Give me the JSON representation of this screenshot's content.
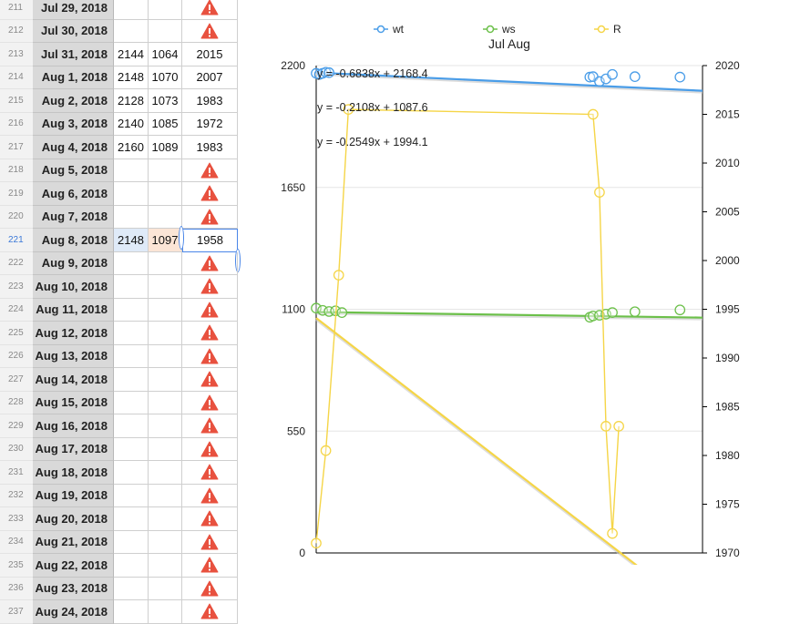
{
  "spreadsheet": {
    "rows": [
      {
        "num": "211",
        "date": "Jul 29, 2018",
        "wt": "",
        "ws": "",
        "r": "",
        "warn": true
      },
      {
        "num": "212",
        "date": "Jul 30, 2018",
        "wt": "",
        "ws": "",
        "r": "",
        "warn": true
      },
      {
        "num": "213",
        "date": "Jul 31, 2018",
        "wt": "2144",
        "ws": "1064",
        "r": "2015",
        "warn": false
      },
      {
        "num": "214",
        "date": "Aug 1, 2018",
        "wt": "2148",
        "ws": "1070",
        "r": "2007",
        "warn": false
      },
      {
        "num": "215",
        "date": "Aug 2, 2018",
        "wt": "2128",
        "ws": "1073",
        "r": "1983",
        "warn": false
      },
      {
        "num": "216",
        "date": "Aug 3, 2018",
        "wt": "2140",
        "ws": "1085",
        "r": "1972",
        "warn": false
      },
      {
        "num": "217",
        "date": "Aug 4, 2018",
        "wt": "2160",
        "ws": "1089",
        "r": "1983",
        "warn": false
      },
      {
        "num": "218",
        "date": "Aug 5, 2018",
        "wt": "",
        "ws": "",
        "r": "",
        "warn": true
      },
      {
        "num": "219",
        "date": "Aug 6, 2018",
        "wt": "",
        "ws": "",
        "r": "",
        "warn": true
      },
      {
        "num": "220",
        "date": "Aug 7, 2018",
        "wt": "",
        "ws": "",
        "r": "",
        "warn": true
      },
      {
        "num": "221",
        "date": "Aug 8, 2018",
        "wt": "2148",
        "ws": "1097",
        "r": "1958",
        "warn": false,
        "selected": true
      },
      {
        "num": "222",
        "date": "Aug 9, 2018",
        "wt": "",
        "ws": "",
        "r": "",
        "warn": true
      },
      {
        "num": "223",
        "date": "Aug 10, 2018",
        "wt": "",
        "ws": "",
        "r": "",
        "warn": true
      },
      {
        "num": "224",
        "date": "Aug 11, 2018",
        "wt": "",
        "ws": "",
        "r": "",
        "warn": true
      },
      {
        "num": "225",
        "date": "Aug 12, 2018",
        "wt": "",
        "ws": "",
        "r": "",
        "warn": true
      },
      {
        "num": "226",
        "date": "Aug 13, 2018",
        "wt": "",
        "ws": "",
        "r": "",
        "warn": true
      },
      {
        "num": "227",
        "date": "Aug 14, 2018",
        "wt": "",
        "ws": "",
        "r": "",
        "warn": true
      },
      {
        "num": "228",
        "date": "Aug 15, 2018",
        "wt": "",
        "ws": "",
        "r": "",
        "warn": true
      },
      {
        "num": "229",
        "date": "Aug 16, 2018",
        "wt": "",
        "ws": "",
        "r": "",
        "warn": true
      },
      {
        "num": "230",
        "date": "Aug 17, 2018",
        "wt": "",
        "ws": "",
        "r": "",
        "warn": true
      },
      {
        "num": "231",
        "date": "Aug 18, 2018",
        "wt": "",
        "ws": "",
        "r": "",
        "warn": true
      },
      {
        "num": "232",
        "date": "Aug 19, 2018",
        "wt": "",
        "ws": "",
        "r": "",
        "warn": true
      },
      {
        "num": "233",
        "date": "Aug 20, 2018",
        "wt": "",
        "ws": "",
        "r": "",
        "warn": true
      },
      {
        "num": "234",
        "date": "Aug 21, 2018",
        "wt": "",
        "ws": "",
        "r": "",
        "warn": true
      },
      {
        "num": "235",
        "date": "Aug 22, 2018",
        "wt": "",
        "ws": "",
        "r": "",
        "warn": true
      },
      {
        "num": "236",
        "date": "Aug 23, 2018",
        "wt": "",
        "ws": "",
        "r": "",
        "warn": true
      },
      {
        "num": "237",
        "date": "Aug 24, 2018",
        "wt": "",
        "ws": "",
        "r": "",
        "warn": true
      }
    ],
    "warning_color": "#e8513f",
    "selection_color": "#4a86e8"
  },
  "chart_data": {
    "type": "scatter",
    "title": "Jul Aug",
    "legend_position": "top",
    "grid": true,
    "y_left_ticks": [
      "2200",
      "1650",
      "1100",
      "550",
      "0"
    ],
    "y_left_range": [
      0,
      2200
    ],
    "y_right_ticks": [
      "2020",
      "2015",
      "2010",
      "2005",
      "2000",
      "1995",
      "1990",
      "1985",
      "1980",
      "1975",
      "1970"
    ],
    "y_right_range": [
      1970,
      2020
    ],
    "trendline_equations": [
      "y = -0.6838x + 2168.4",
      "y = -0.2108x + 1087.6",
      "y = -0.2549x + 1994.1"
    ],
    "series": [
      {
        "name": "wt",
        "axis": "left",
        "color": "#4a9de8",
        "line": false,
        "x": [
          0,
          1,
          2,
          3,
          4,
          85,
          86,
          88,
          90,
          92,
          99,
          113
        ],
        "y": [
          2165,
          2160,
          2165,
          2170,
          2168,
          2148,
          2150,
          2128,
          2140,
          2160,
          2150,
          2148
        ],
        "trend": {
          "slope": -0.6838,
          "intercept": 2168.4
        }
      },
      {
        "name": "ws",
        "axis": "left",
        "color": "#6cc04a",
        "line": false,
        "x": [
          0,
          2,
          4,
          6,
          8,
          85,
          86,
          88,
          90,
          92,
          99,
          113
        ],
        "y": [
          1105,
          1095,
          1090,
          1093,
          1085,
          1064,
          1070,
          1073,
          1078,
          1085,
          1089,
          1097
        ],
        "trend": {
          "slope": -0.2108,
          "intercept": 1087.6
        }
      },
      {
        "name": "R",
        "axis": "right",
        "color": "#f5d547",
        "line": true,
        "x": [
          0,
          3,
          7,
          10,
          86,
          88,
          90,
          92,
          94
        ],
        "y": [
          1971,
          1980.5,
          1998.5,
          2015.5,
          2015,
          2007,
          1983,
          1972,
          1983
        ],
        "trend": {
          "slope": -0.2549,
          "intercept": 1994.1
        }
      }
    ]
  }
}
